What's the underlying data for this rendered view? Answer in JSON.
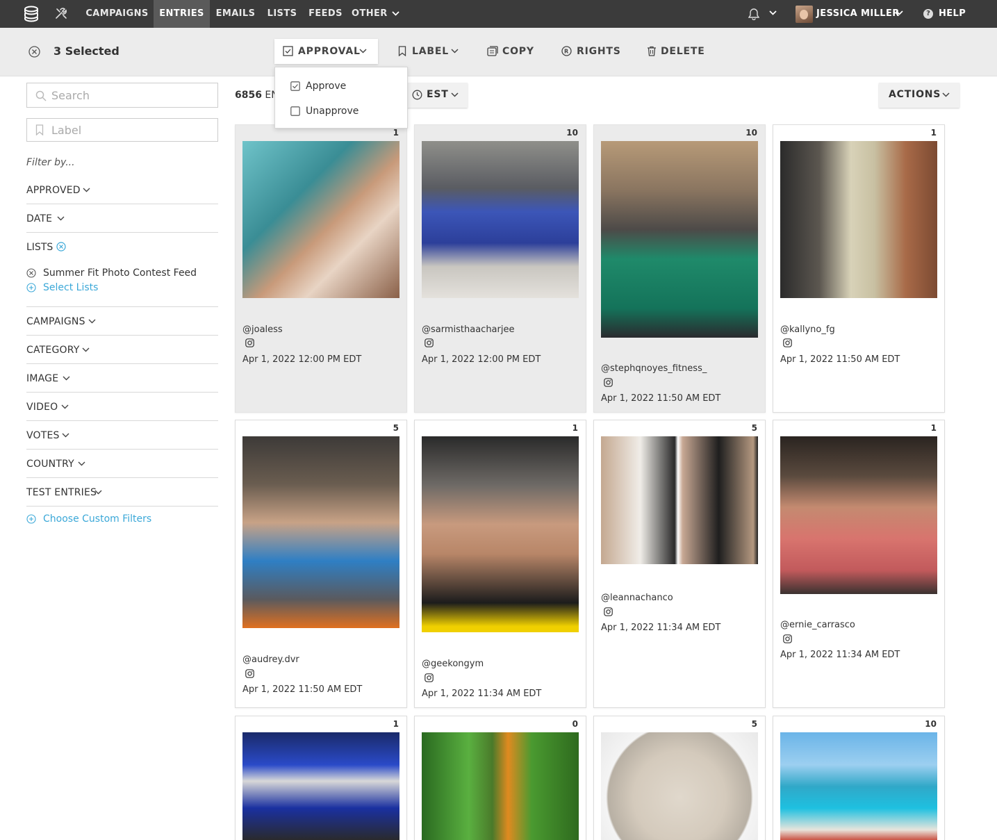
{
  "nav": {
    "items": [
      "CAMPAIGNS",
      "ENTRIES",
      "EMAILS",
      "LISTS",
      "FEEDS",
      "OTHER"
    ],
    "active": "ENTRIES",
    "user_name": "JESSICA MILLER",
    "help_label": "HELP"
  },
  "selection": {
    "count_label": "3 Selected",
    "approval_label": "APPROVAL",
    "label_label": "LABEL",
    "copy_label": "COPY",
    "rights_label": "RIGHTS",
    "delete_label": "DELETE"
  },
  "approval_menu": {
    "approve": "Approve",
    "unapprove": "Unapprove"
  },
  "sidebar": {
    "search_placeholder": "Search",
    "label_placeholder": "Label",
    "filter_by": "Filter by...",
    "approved": "APPROVED",
    "date": "DATE",
    "lists": "LISTS",
    "list_selected": "Summer Fit Photo Contest Feed",
    "select_lists": "Select Lists",
    "campaigns": "CAMPAIGNS",
    "category": "CATEGORY",
    "image": "IMAGE",
    "video": "VIDEO",
    "votes": "VOTES",
    "country": "COUNTRY",
    "test_entries": "TEST ENTRIES",
    "custom_filters": "Choose Custom Filters"
  },
  "main": {
    "entries_count": "6856",
    "entries_suffix": "ENT",
    "sort_label": "EST",
    "actions_label": "ACTIONS"
  },
  "cards": [
    {
      "score": "1",
      "handle": "@joaless",
      "date": "Apr 1, 2022 12:00 PM EDT",
      "selected": true
    },
    {
      "score": "10",
      "handle": "@sarmisthaacharjee",
      "date": "Apr 1, 2022 12:00 PM EDT",
      "selected": true
    },
    {
      "score": "10",
      "handle": "@stephqnoyes_fitness_",
      "date": "Apr 1, 2022 11:50 AM EDT",
      "selected": true
    },
    {
      "score": "1",
      "handle": "@kallyno_fg",
      "date": "Apr 1, 2022 11:50 AM EDT",
      "selected": false
    },
    {
      "score": "5",
      "handle": "@audrey.dvr",
      "date": "Apr 1, 2022 11:50 AM EDT",
      "selected": false
    },
    {
      "score": "1",
      "handle": "@geekongym",
      "date": "Apr 1, 2022 11:34 AM EDT",
      "selected": false
    },
    {
      "score": "5",
      "handle": "@leannachanco",
      "date": "Apr 1, 2022 11:34 AM EDT",
      "selected": false
    },
    {
      "score": "1",
      "handle": "@ernie_carrasco",
      "date": "Apr 1, 2022 11:34 AM EDT",
      "selected": false
    },
    {
      "score": "1",
      "handle": "",
      "date": "",
      "selected": false
    },
    {
      "score": "0",
      "handle": "",
      "date": "",
      "selected": false
    },
    {
      "score": "5",
      "handle": "",
      "date": "",
      "selected": false
    },
    {
      "score": "10",
      "handle": "",
      "date": "",
      "selected": false
    }
  ],
  "colors": {
    "nav_bg": "#3b3b3b",
    "toolbar_bg": "#ececec",
    "accent_teal": "#3ba8d8",
    "selected_card_bg": "#ebebeb"
  }
}
